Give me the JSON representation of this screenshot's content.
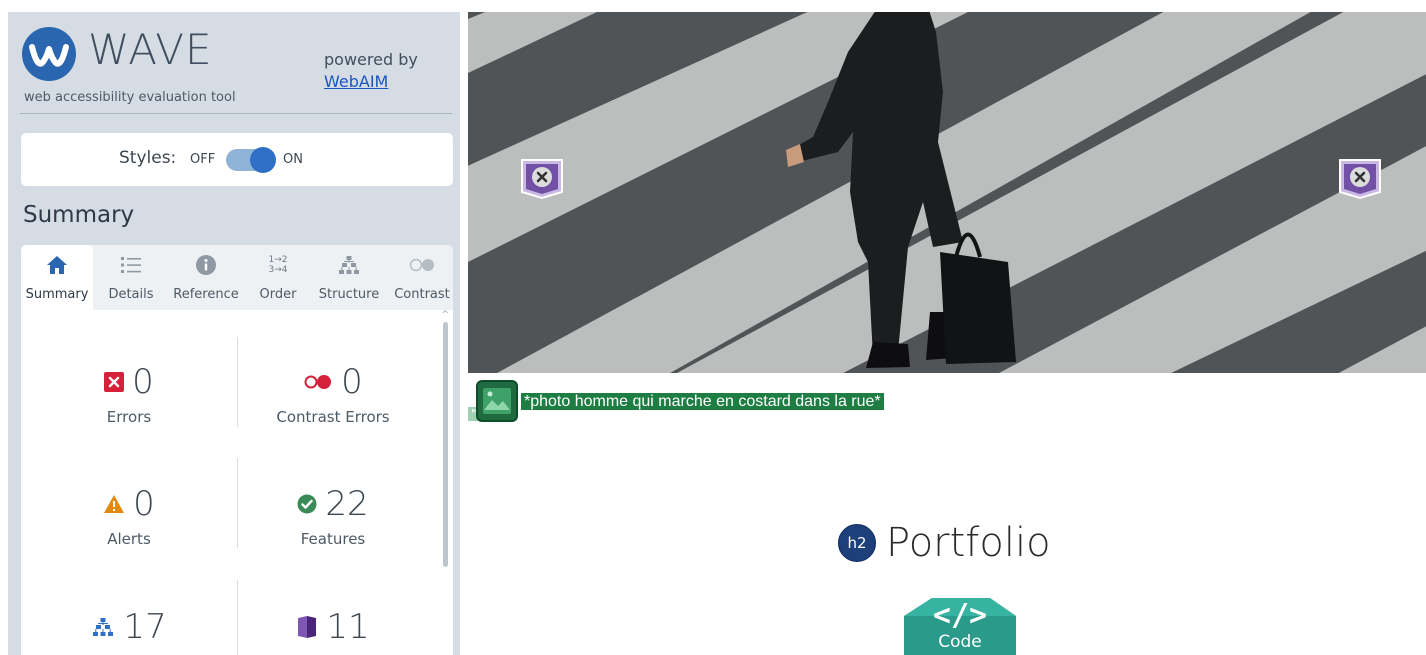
{
  "wave": {
    "title": "WAVE",
    "subtitle": "web accessibility evaluation tool",
    "powered_by": "powered by",
    "webaim_link": "WebAIM",
    "styles": {
      "label": "Styles:",
      "off": "OFF",
      "on": "ON",
      "enabled": true
    },
    "summary_heading": "Summary",
    "tabs": [
      {
        "label": "Summary",
        "icon": "home-icon",
        "active": true
      },
      {
        "label": "Details",
        "icon": "list-icon",
        "active": false
      },
      {
        "label": "Reference",
        "icon": "info-icon",
        "active": false
      },
      {
        "label": "Order",
        "icon": "order-icon",
        "order_glyph": "1→2\n3→4",
        "active": false
      },
      {
        "label": "Structure",
        "icon": "structure-icon",
        "active": false
      },
      {
        "label": "Contrast",
        "icon": "contrast-icon",
        "active": false
      }
    ],
    "stats": {
      "errors": {
        "count": "0",
        "label": "Errors",
        "icon": "error-icon",
        "color": "#d6213a"
      },
      "contrast_errors": {
        "count": "0",
        "label": "Contrast Errors",
        "icon": "contrast-error-icon",
        "color": "#d6213a"
      },
      "alerts": {
        "count": "0",
        "label": "Alerts",
        "icon": "alert-icon",
        "color": "#e08a13"
      },
      "features": {
        "count": "22",
        "label": "Features",
        "icon": "feature-icon",
        "color": "#3d8a59"
      },
      "structure": {
        "count": "17",
        "icon": "structure-icon",
        "color": "#2f6fc5"
      },
      "aria": {
        "count": "11",
        "icon": "aria-icon",
        "color": "#5a2f8f"
      }
    }
  },
  "page": {
    "hero_flags": [
      "aria-hidden-icon",
      "aria-hidden-icon"
    ],
    "image_alt": "*photo homme qui marche en costard dans la rue*",
    "ghost_text": "\" 2\"",
    "heading_tag": "h2",
    "heading": "Portfolio",
    "code_glyph": "</>",
    "code_label": "Code"
  },
  "colors": {
    "sidebar_bg": "#d6dce3",
    "wave_blue": "#2a66b0",
    "alt_green": "#1e7d43",
    "code_teal": "#2a9a8a",
    "aria_purple": "#6b4a9e"
  }
}
